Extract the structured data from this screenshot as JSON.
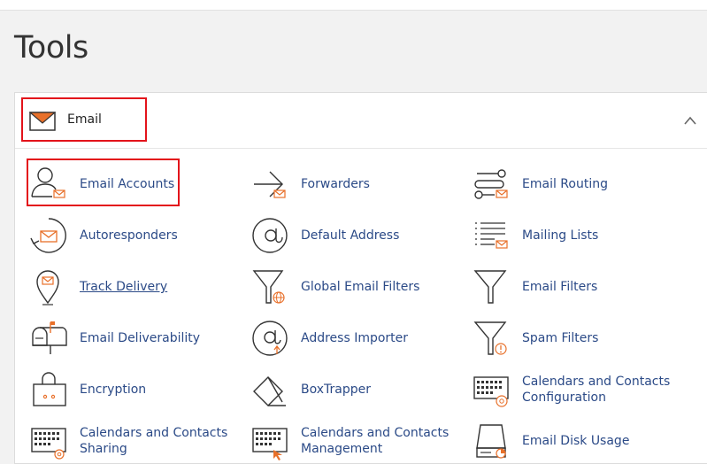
{
  "page": {
    "title": "Tools"
  },
  "email_section": {
    "title": "Email",
    "icon": "envelope-icon",
    "colors": {
      "accent": "#e8702a",
      "link": "#2b4a87",
      "highlight": "#e3131b"
    }
  },
  "tools": [
    {
      "label": "Email Accounts",
      "icon": "user-email-icon"
    },
    {
      "label": "Forwarders",
      "icon": "forward-arrow-icon"
    },
    {
      "label": "Email Routing",
      "icon": "routing-icon"
    },
    {
      "label": "Autoresponders",
      "icon": "autoresponder-icon"
    },
    {
      "label": "Default Address",
      "icon": "at-sign-icon"
    },
    {
      "label": "Mailing Lists",
      "icon": "mailing-list-icon"
    },
    {
      "label": "Track Delivery",
      "icon": "map-pin-email-icon"
    },
    {
      "label": "Global Email Filters",
      "icon": "funnel-globe-icon"
    },
    {
      "label": "Email Filters",
      "icon": "funnel-icon"
    },
    {
      "label": "Email Deliverability",
      "icon": "mailbox-icon"
    },
    {
      "label": "Address Importer",
      "icon": "at-import-icon"
    },
    {
      "label": "Spam Filters",
      "icon": "funnel-warning-icon"
    },
    {
      "label": "Encryption",
      "icon": "lock-box-icon"
    },
    {
      "label": "BoxTrapper",
      "icon": "box-trap-icon"
    },
    {
      "label_line1": "Calendars and Contacts",
      "label_line2": "Configuration",
      "icon": "calendar-at-icon"
    },
    {
      "label_line1": "Calendars and Contacts",
      "label_line2": "Sharing",
      "icon": "calendar-gear-icon"
    },
    {
      "label_line1": "Calendars and Contacts",
      "label_line2": "Management",
      "icon": "calendar-arrow-icon"
    },
    {
      "label": "Email Disk Usage",
      "icon": "disk-usage-icon"
    }
  ]
}
